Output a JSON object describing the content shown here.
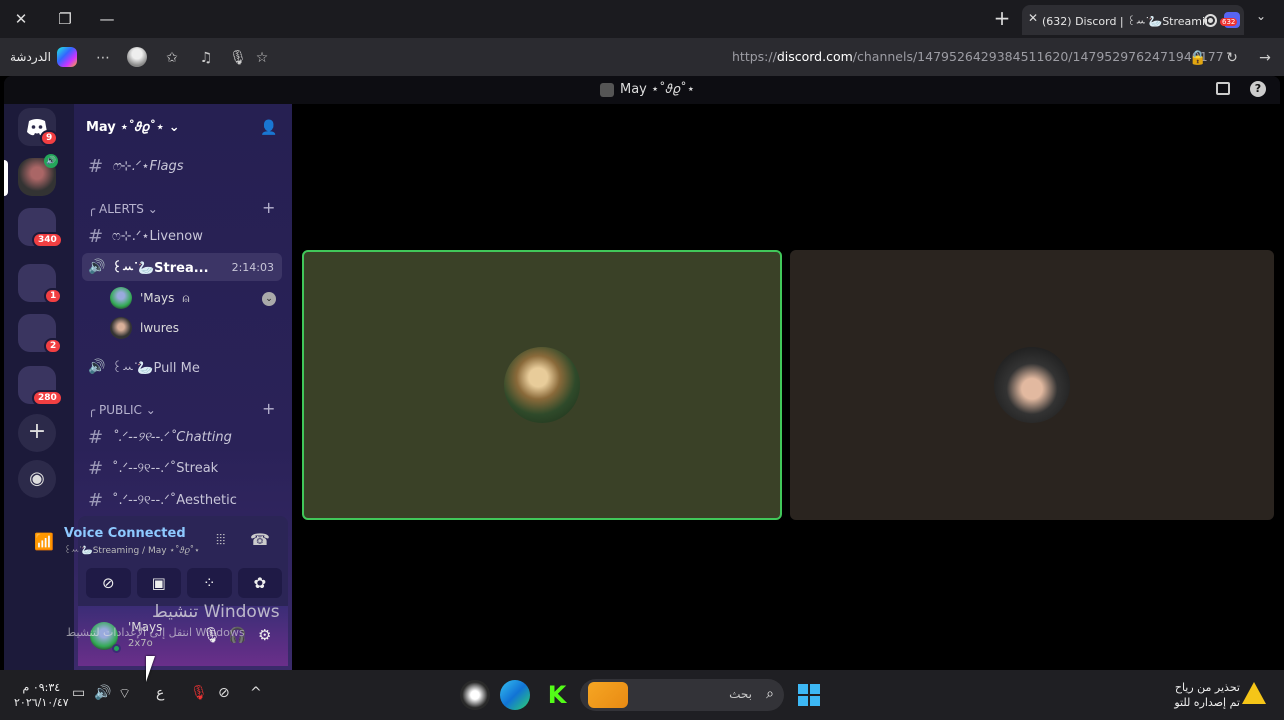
{
  "browser": {
    "tab_title": "(632) Discord | ꒰ꕀᐝ🦢Streamin",
    "tab_badge": "632",
    "url_prefix": "https://",
    "url_host": "discord.com",
    "url_path": "/channels/1479526429384511620/1479529762471940177",
    "chat_label": "الدردشة"
  },
  "discord": {
    "window_title": "May ⋆˚𝜗𝜚˚⋆",
    "rail_badges": [
      "9",
      "340",
      "1",
      "2",
      "280"
    ],
    "server_name": "May ⋆˚𝜗𝜚˚⋆",
    "channels": [
      {
        "kind": "text",
        "label": "ෆ⊹.ᐟ⋆Flags"
      },
      {
        "kind": "category",
        "label": "╭ ALERTS"
      },
      {
        "kind": "text",
        "label": "ෆ⊹.ᐟ⋆Livenow"
      },
      {
        "kind": "voice",
        "label": "꒰ꕀᐝ🦢Strea...",
        "time": "2:14:03"
      },
      {
        "kind": "voice",
        "label": "꒰ꕀᐝ🦢Pull Me"
      },
      {
        "kind": "category",
        "label": "╭ PUBLIC"
      },
      {
        "kind": "text",
        "label": "˚.ᐟ--୨୧--.ᐟ˚Chatting"
      },
      {
        "kind": "text",
        "label": "˚.ᐟ--୨୧--.ᐟ˚Streak"
      },
      {
        "kind": "text",
        "label": "˚.ᐟ--୨୧--.ᐟ˚Aesthetic"
      }
    ],
    "voice_users": [
      "'Mays",
      "lwures"
    ],
    "voice_panel": {
      "status": "Voice Connected",
      "sub": "꒰ꕀᐝ🦢Streaming / May ⋆˚𝜗𝜚˚⋆"
    },
    "user": {
      "name": "'Mays",
      "status": "2x7o"
    },
    "watermark_1": "تنشيط Windows",
    "watermark_2": "انتقل إلى الإعدادات لتنشيط Windows"
  },
  "taskbar": {
    "time": "٠٩:٣٤ م",
    "date": "٢٠٢٦/١٠/٤٧",
    "lang": "ع",
    "search_label": "بحث",
    "warn_line1": "تحذير من رياح",
    "warn_line2": "تم إصداره للتو"
  },
  "colors": {
    "accent": "#5865f2",
    "speaking_border": "#41c75a",
    "voice_connected": "#8ec9ff",
    "badge": "#f23f42",
    "online": "#23a55a"
  }
}
